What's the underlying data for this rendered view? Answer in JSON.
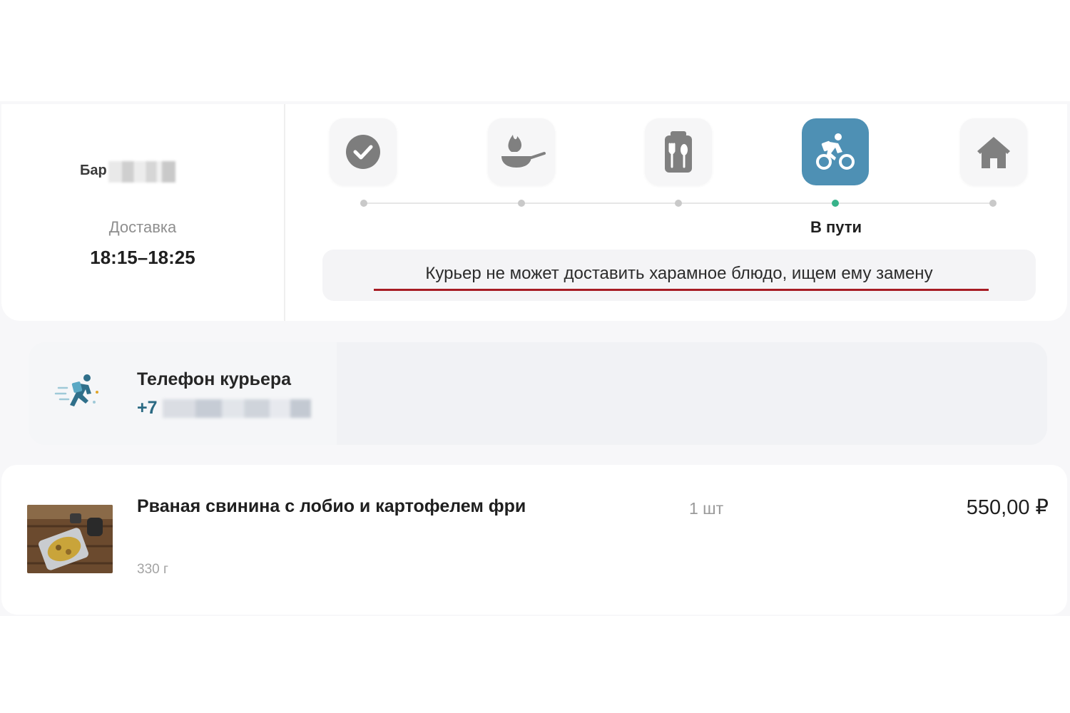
{
  "order": {
    "venue_label": "Бар",
    "delivery_label": "Доставка",
    "delivery_time": "18:15–18:25"
  },
  "progress": {
    "steps": [
      {
        "icon": "check-circle-icon",
        "state": "done"
      },
      {
        "icon": "frying-pan-icon",
        "state": "done"
      },
      {
        "icon": "packed-food-icon",
        "state": "done"
      },
      {
        "icon": "courier-bike-icon",
        "state": "active"
      },
      {
        "icon": "home-icon",
        "state": "pending"
      }
    ],
    "active_index": 3,
    "active_label": "В пути",
    "message": "Курьер не может доставить харамное блюдо, ищем ему замену",
    "active_color": "#4e90b4",
    "active_dot_color": "#37b38a",
    "underline_color": "#a71c24"
  },
  "courier": {
    "title": "Телефон курьера",
    "phone_prefix": "+7"
  },
  "item": {
    "name": "Рваная свинина с лобио и картофелем фри",
    "quantity": "1 шт",
    "price": "550,00 ₽",
    "weight": "330 г"
  }
}
